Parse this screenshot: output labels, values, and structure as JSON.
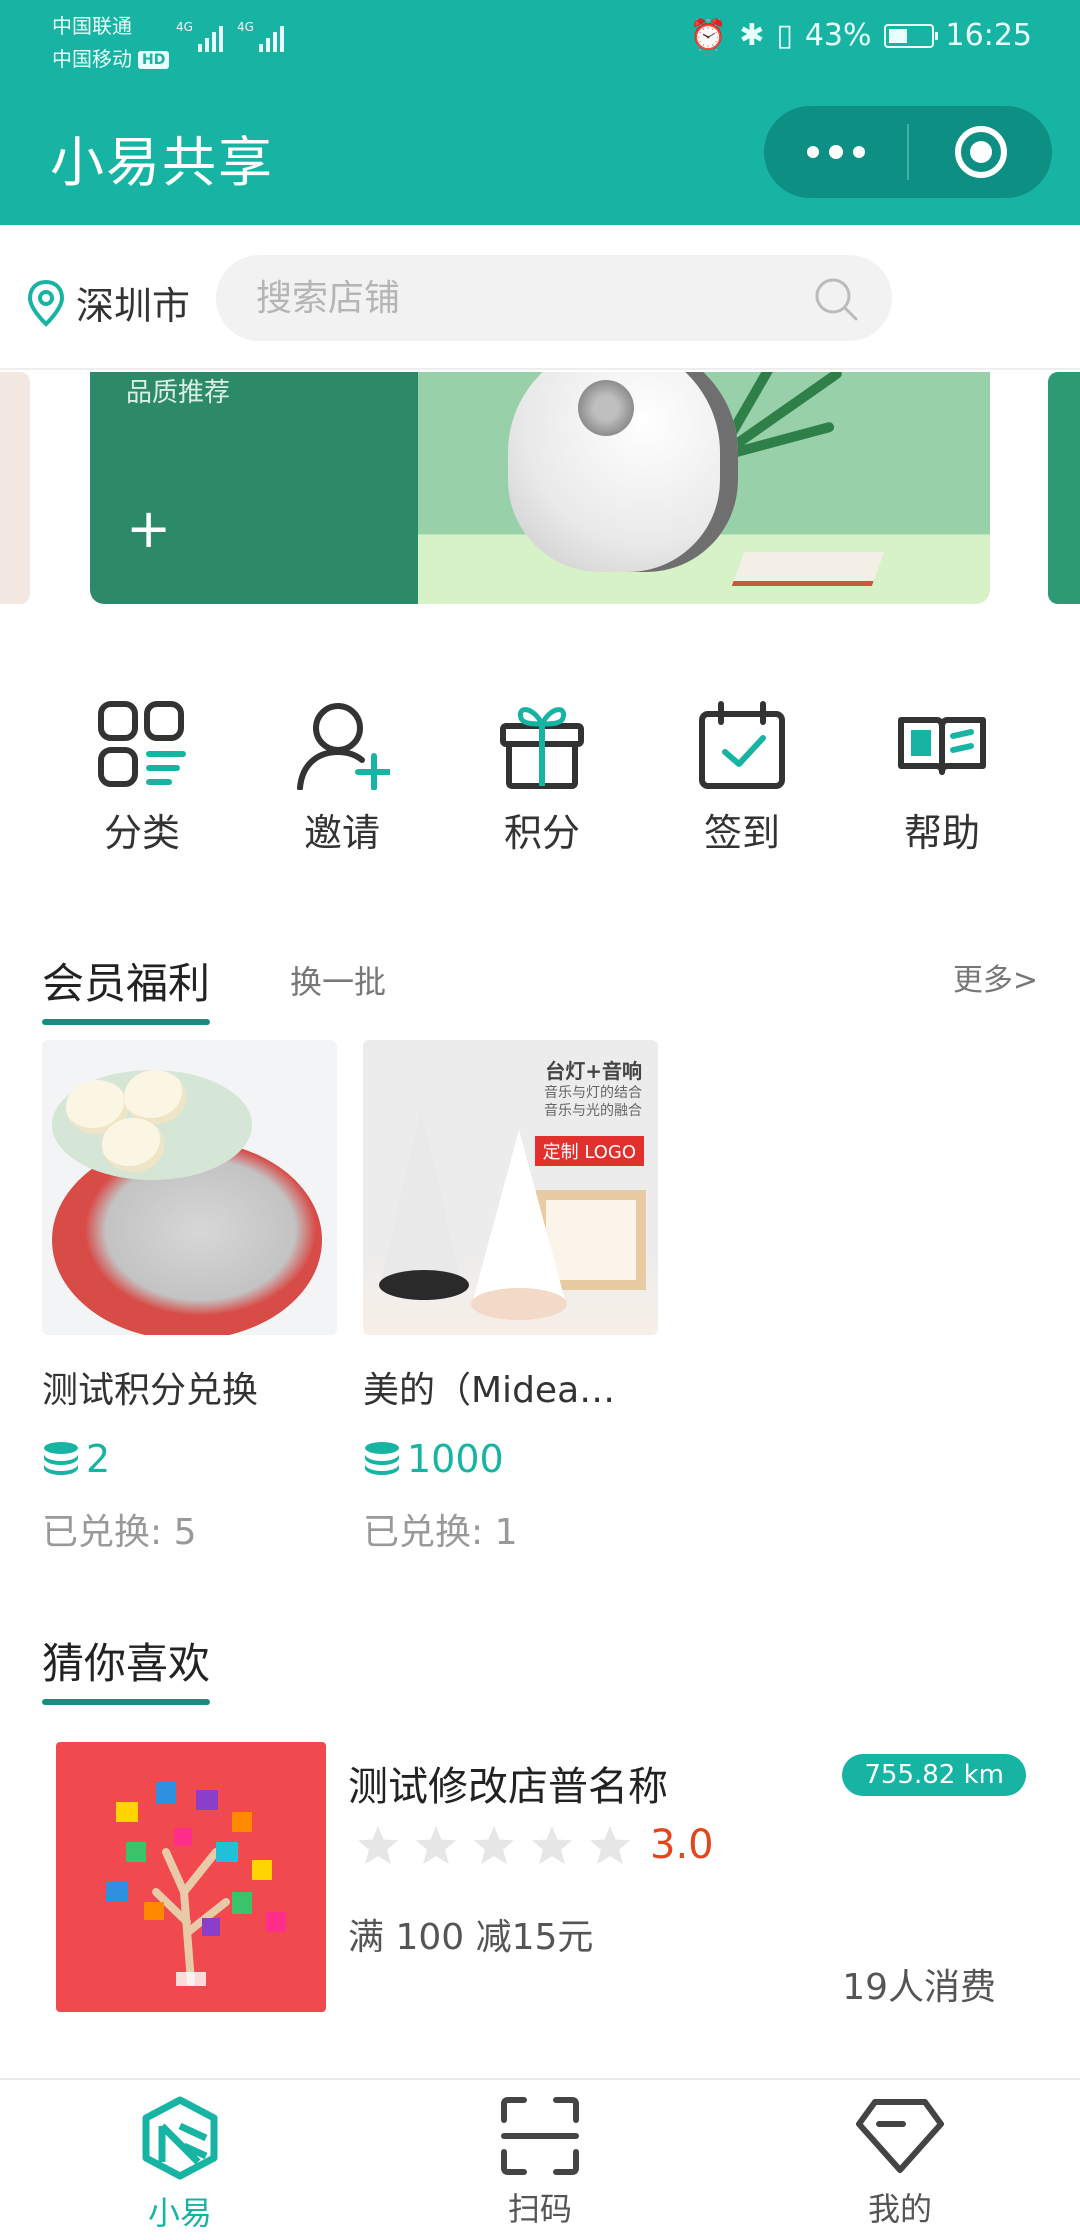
{
  "status_bar": {
    "carrier1": "中国联通",
    "carrier2": "中国移动",
    "hd_badge": "HD",
    "net1": "4G",
    "net2": "4G",
    "battery": "43%",
    "time": "16:25"
  },
  "header": {
    "title": "小易共享"
  },
  "location": {
    "city": "深圳市"
  },
  "search": {
    "placeholder": "搜索店铺"
  },
  "banner": {
    "tag": "品质推荐",
    "plus": "+"
  },
  "quick_menu": [
    {
      "label": "分类",
      "icon": "category-icon"
    },
    {
      "label": "邀请",
      "icon": "invite-icon"
    },
    {
      "label": "积分",
      "icon": "gift-icon"
    },
    {
      "label": "签到",
      "icon": "checkin-icon"
    },
    {
      "label": "帮助",
      "icon": "help-book-icon"
    }
  ],
  "member_section": {
    "title": "会员福利",
    "refresh": "换一批",
    "more": "更多>",
    "items": [
      {
        "name": "测试积分兑换",
        "points": "2",
        "sold": "已兑换: 5"
      },
      {
        "name": "美的（Midea…",
        "points": "1000",
        "sold": "已兑换: 1",
        "img_title": "台灯+音响",
        "img_sub1": "音乐与灯的结合",
        "img_sub2": "音乐与光的融合",
        "img_badge": "定制 LOGO"
      }
    ]
  },
  "recommend_section": {
    "title": "猜你喜欢",
    "shops": [
      {
        "name": "测试修改店普名称",
        "distance": "755.82 km",
        "rating": "3.0",
        "stars": 0,
        "promo": "满 100 减15元",
        "consumers": "19人消费"
      }
    ]
  },
  "tabbar": {
    "items": [
      {
        "label": "小易",
        "icon": "home-logo-icon",
        "active": true
      },
      {
        "label": "扫码",
        "icon": "scan-icon",
        "active": false
      },
      {
        "label": "我的",
        "icon": "diamond-icon",
        "active": false
      }
    ]
  },
  "colors": {
    "accent": "#17b3a3",
    "accent_dark": "#118f82",
    "rating": "#e2461d"
  }
}
